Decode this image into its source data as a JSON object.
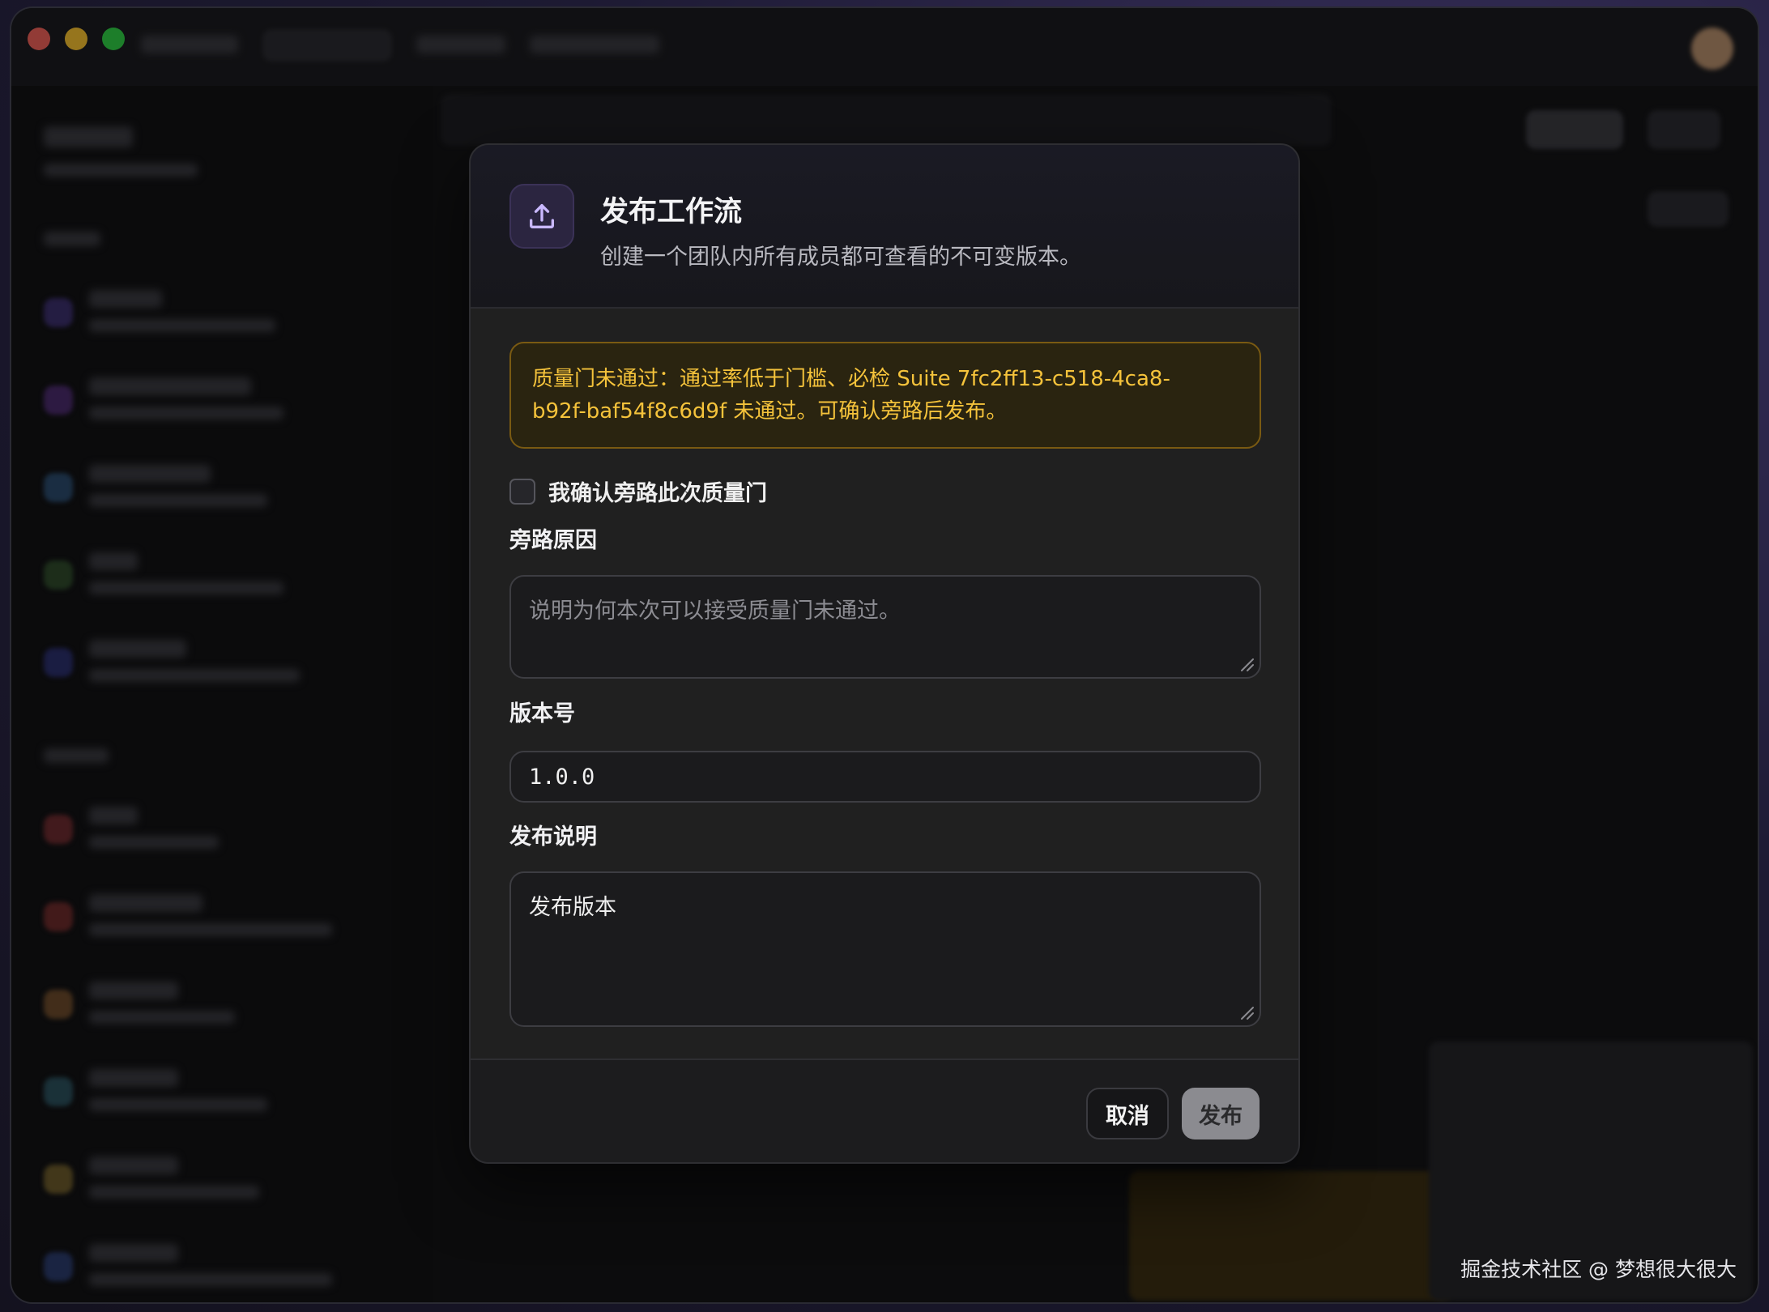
{
  "modal": {
    "title": "发布工作流",
    "subtitle": "创建一个团队内所有成员都可查看的不可变版本。",
    "icon": "upload-icon",
    "warning": {
      "line1": "质量门未通过：通过率低于门槛、必检 Suite 7fc2ff13-c518-4ca8-",
      "line2": "b92f-baf54f8c6d9f 未通过。可确认旁路后发布。",
      "color": "#f5c33b"
    },
    "bypass_checkbox": {
      "label": "我确认旁路此次质量门",
      "checked": false
    },
    "bypass_reason": {
      "label": "旁路原因",
      "placeholder": "说明为何本次可以接受质量门未通过。",
      "value": ""
    },
    "version": {
      "label": "版本号",
      "value": "1.0.0"
    },
    "release_notes": {
      "label": "发布说明",
      "value": "发布版本"
    },
    "buttons": {
      "cancel": "取消",
      "publish": "发布"
    }
  },
  "watermark": "掘金技术社区 @ 梦想很大很大",
  "colors": {
    "accent_purple": "#8b6fd6",
    "warning_text": "#f5c33b",
    "warning_border": "#7a5a12"
  }
}
